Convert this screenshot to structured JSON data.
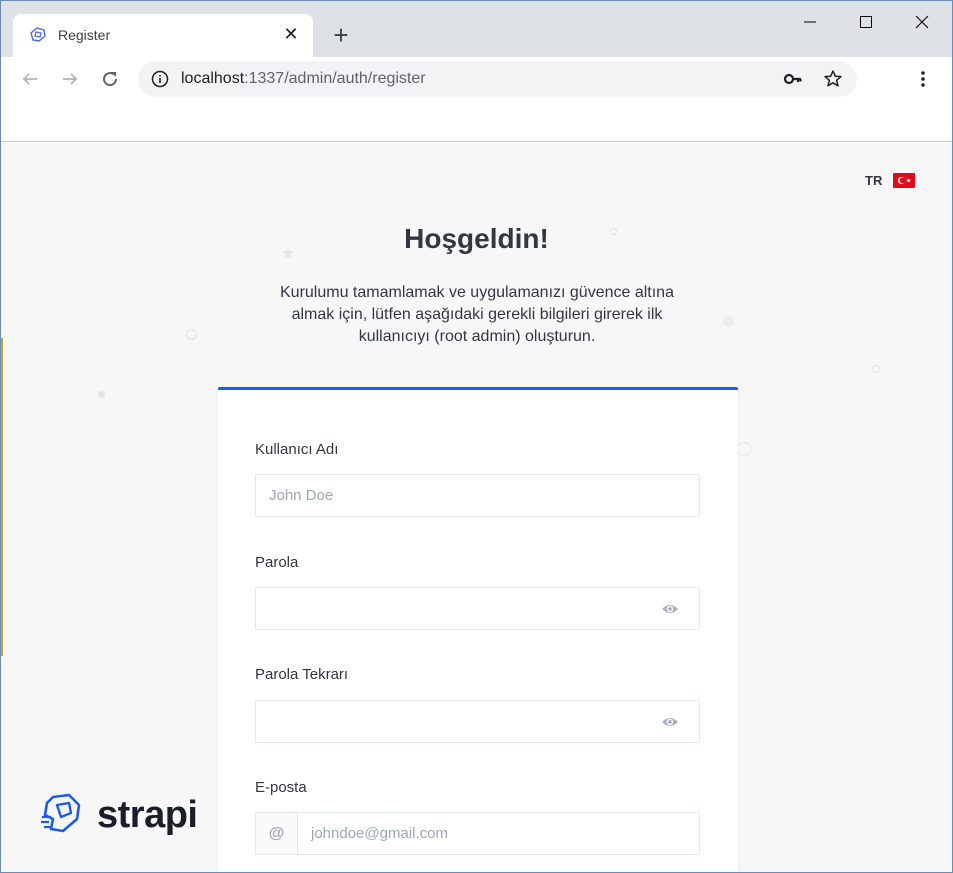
{
  "browser": {
    "tab": {
      "title": "Register",
      "favicon": "strapi-favicon-icon",
      "close_glyph": "✕"
    },
    "new_tab_glyph": "+",
    "address": {
      "host": "localhost",
      "rest": ":1337/admin/auth/register"
    },
    "icons": [
      "back-arrow-icon",
      "forward-arrow-icon",
      "reload-icon",
      "info-icon",
      "key-icon",
      "star-icon",
      "menu-dots-icon",
      "minimize-icon",
      "maximize-icon",
      "close-icon"
    ]
  },
  "page": {
    "language": {
      "code": "TR",
      "flag": "turkey-flag-icon"
    },
    "title": "Hoşgeldin!",
    "subtitle": "Kurulumu tamamlamak ve uygulamanızı güvence altına almak için, lütfen aşağıdaki gerekli bilgileri girerek ilk kullanıcıyı (root admin) oluşturun.",
    "form": {
      "username": {
        "label": "Kullanıcı Adı",
        "placeholder": "John Doe",
        "value": ""
      },
      "password": {
        "label": "Parola",
        "value": ""
      },
      "password_confirm": {
        "label": "Parola Tekrarı",
        "value": ""
      },
      "email": {
        "label": "E-posta",
        "addon": "@",
        "placeholder": "johndoe@gmail.com",
        "value": ""
      }
    },
    "brand": {
      "name": "strapi"
    }
  },
  "colors": {
    "accent": "#1c5de7",
    "text": "#333740",
    "page_bg": "#f7f7f7",
    "flag_red": "#e30a17"
  }
}
